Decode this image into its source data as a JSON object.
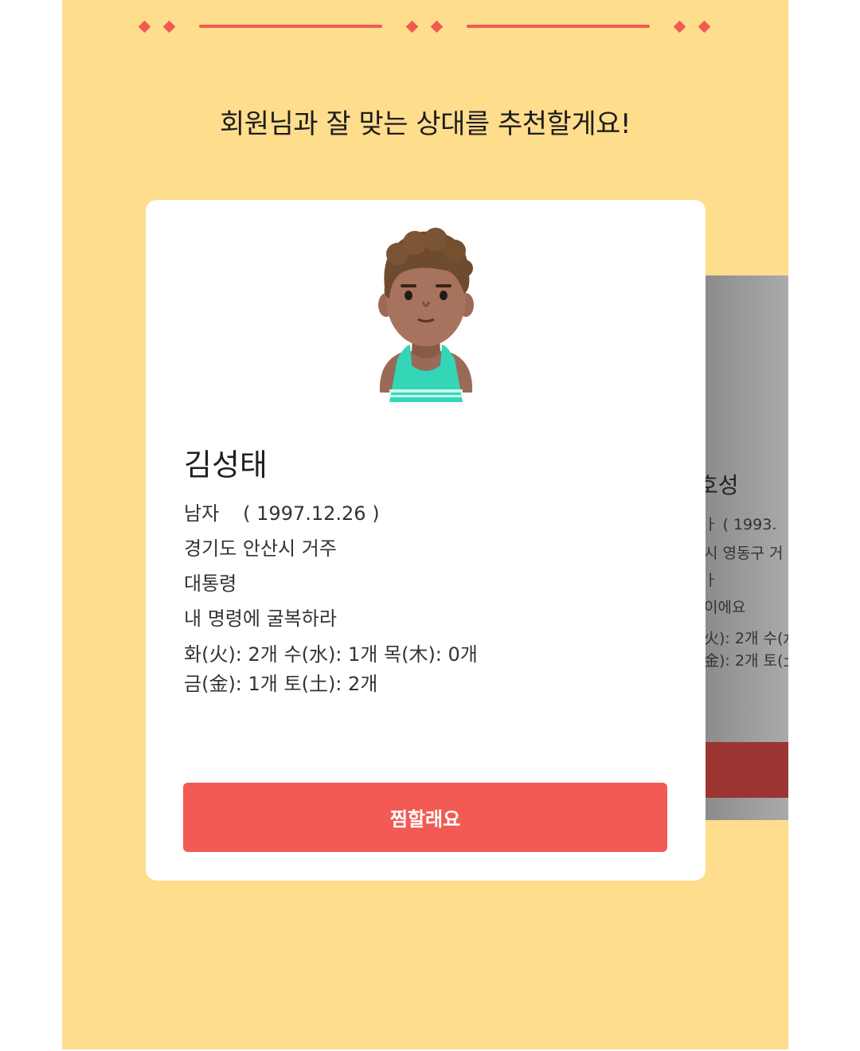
{
  "headline": "회원님과 잘 맞는 상대를 추천할게요!",
  "colors": {
    "background": "#FEDD8D",
    "accent": "#F25A50",
    "card": "#FFFFFF",
    "button": "#F25A53"
  },
  "main_card": {
    "avatar_icon": "boy-avatar-icon",
    "name": "김성태",
    "gender": "남자",
    "birth": "( 1997.12.26 )",
    "location": "경기도 안산시 거주",
    "occupation": "대통령",
    "intro": "내 명령에 굴복하라",
    "elements_line1": "화(火): 2개 수(水): 1개 목(木): 0개",
    "elements_line2": "금(金): 1개 토(土): 2개",
    "button_label": "찜할래요"
  },
  "back_card": {
    "name_fragment": "호성",
    "line1_fragment": "ㅏ     ( 1993.",
    "line2_fragment": "시 영동구 거",
    "line3_fragment": "ㅏ",
    "line4_fragment": "이에요",
    "line5_fragment": "火): 2개 수(水",
    "line6_fragment": "金): 2개 토(土"
  }
}
